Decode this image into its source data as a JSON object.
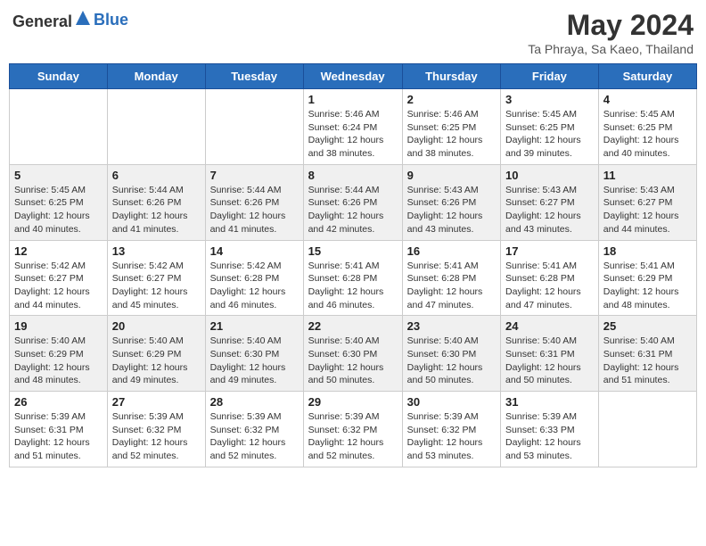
{
  "header": {
    "logo_general": "General",
    "logo_blue": "Blue",
    "month_title": "May 2024",
    "location": "Ta Phraya, Sa Kaeo, Thailand"
  },
  "days_of_week": [
    "Sunday",
    "Monday",
    "Tuesday",
    "Wednesday",
    "Thursday",
    "Friday",
    "Saturday"
  ],
  "weeks": [
    [
      {
        "day": "",
        "info": ""
      },
      {
        "day": "",
        "info": ""
      },
      {
        "day": "",
        "info": ""
      },
      {
        "day": "1",
        "info": "Sunrise: 5:46 AM\nSunset: 6:24 PM\nDaylight: 12 hours and 38 minutes."
      },
      {
        "day": "2",
        "info": "Sunrise: 5:46 AM\nSunset: 6:25 PM\nDaylight: 12 hours and 38 minutes."
      },
      {
        "day": "3",
        "info": "Sunrise: 5:45 AM\nSunset: 6:25 PM\nDaylight: 12 hours and 39 minutes."
      },
      {
        "day": "4",
        "info": "Sunrise: 5:45 AM\nSunset: 6:25 PM\nDaylight: 12 hours and 40 minutes."
      }
    ],
    [
      {
        "day": "5",
        "info": "Sunrise: 5:45 AM\nSunset: 6:25 PM\nDaylight: 12 hours and 40 minutes."
      },
      {
        "day": "6",
        "info": "Sunrise: 5:44 AM\nSunset: 6:26 PM\nDaylight: 12 hours and 41 minutes."
      },
      {
        "day": "7",
        "info": "Sunrise: 5:44 AM\nSunset: 6:26 PM\nDaylight: 12 hours and 41 minutes."
      },
      {
        "day": "8",
        "info": "Sunrise: 5:44 AM\nSunset: 6:26 PM\nDaylight: 12 hours and 42 minutes."
      },
      {
        "day": "9",
        "info": "Sunrise: 5:43 AM\nSunset: 6:26 PM\nDaylight: 12 hours and 43 minutes."
      },
      {
        "day": "10",
        "info": "Sunrise: 5:43 AM\nSunset: 6:27 PM\nDaylight: 12 hours and 43 minutes."
      },
      {
        "day": "11",
        "info": "Sunrise: 5:43 AM\nSunset: 6:27 PM\nDaylight: 12 hours and 44 minutes."
      }
    ],
    [
      {
        "day": "12",
        "info": "Sunrise: 5:42 AM\nSunset: 6:27 PM\nDaylight: 12 hours and 44 minutes."
      },
      {
        "day": "13",
        "info": "Sunrise: 5:42 AM\nSunset: 6:27 PM\nDaylight: 12 hours and 45 minutes."
      },
      {
        "day": "14",
        "info": "Sunrise: 5:42 AM\nSunset: 6:28 PM\nDaylight: 12 hours and 46 minutes."
      },
      {
        "day": "15",
        "info": "Sunrise: 5:41 AM\nSunset: 6:28 PM\nDaylight: 12 hours and 46 minutes."
      },
      {
        "day": "16",
        "info": "Sunrise: 5:41 AM\nSunset: 6:28 PM\nDaylight: 12 hours and 47 minutes."
      },
      {
        "day": "17",
        "info": "Sunrise: 5:41 AM\nSunset: 6:28 PM\nDaylight: 12 hours and 47 minutes."
      },
      {
        "day": "18",
        "info": "Sunrise: 5:41 AM\nSunset: 6:29 PM\nDaylight: 12 hours and 48 minutes."
      }
    ],
    [
      {
        "day": "19",
        "info": "Sunrise: 5:40 AM\nSunset: 6:29 PM\nDaylight: 12 hours and 48 minutes."
      },
      {
        "day": "20",
        "info": "Sunrise: 5:40 AM\nSunset: 6:29 PM\nDaylight: 12 hours and 49 minutes."
      },
      {
        "day": "21",
        "info": "Sunrise: 5:40 AM\nSunset: 6:30 PM\nDaylight: 12 hours and 49 minutes."
      },
      {
        "day": "22",
        "info": "Sunrise: 5:40 AM\nSunset: 6:30 PM\nDaylight: 12 hours and 50 minutes."
      },
      {
        "day": "23",
        "info": "Sunrise: 5:40 AM\nSunset: 6:30 PM\nDaylight: 12 hours and 50 minutes."
      },
      {
        "day": "24",
        "info": "Sunrise: 5:40 AM\nSunset: 6:31 PM\nDaylight: 12 hours and 50 minutes."
      },
      {
        "day": "25",
        "info": "Sunrise: 5:40 AM\nSunset: 6:31 PM\nDaylight: 12 hours and 51 minutes."
      }
    ],
    [
      {
        "day": "26",
        "info": "Sunrise: 5:39 AM\nSunset: 6:31 PM\nDaylight: 12 hours and 51 minutes."
      },
      {
        "day": "27",
        "info": "Sunrise: 5:39 AM\nSunset: 6:32 PM\nDaylight: 12 hours and 52 minutes."
      },
      {
        "day": "28",
        "info": "Sunrise: 5:39 AM\nSunset: 6:32 PM\nDaylight: 12 hours and 52 minutes."
      },
      {
        "day": "29",
        "info": "Sunrise: 5:39 AM\nSunset: 6:32 PM\nDaylight: 12 hours and 52 minutes."
      },
      {
        "day": "30",
        "info": "Sunrise: 5:39 AM\nSunset: 6:32 PM\nDaylight: 12 hours and 53 minutes."
      },
      {
        "day": "31",
        "info": "Sunrise: 5:39 AM\nSunset: 6:33 PM\nDaylight: 12 hours and 53 minutes."
      },
      {
        "day": "",
        "info": ""
      }
    ]
  ]
}
